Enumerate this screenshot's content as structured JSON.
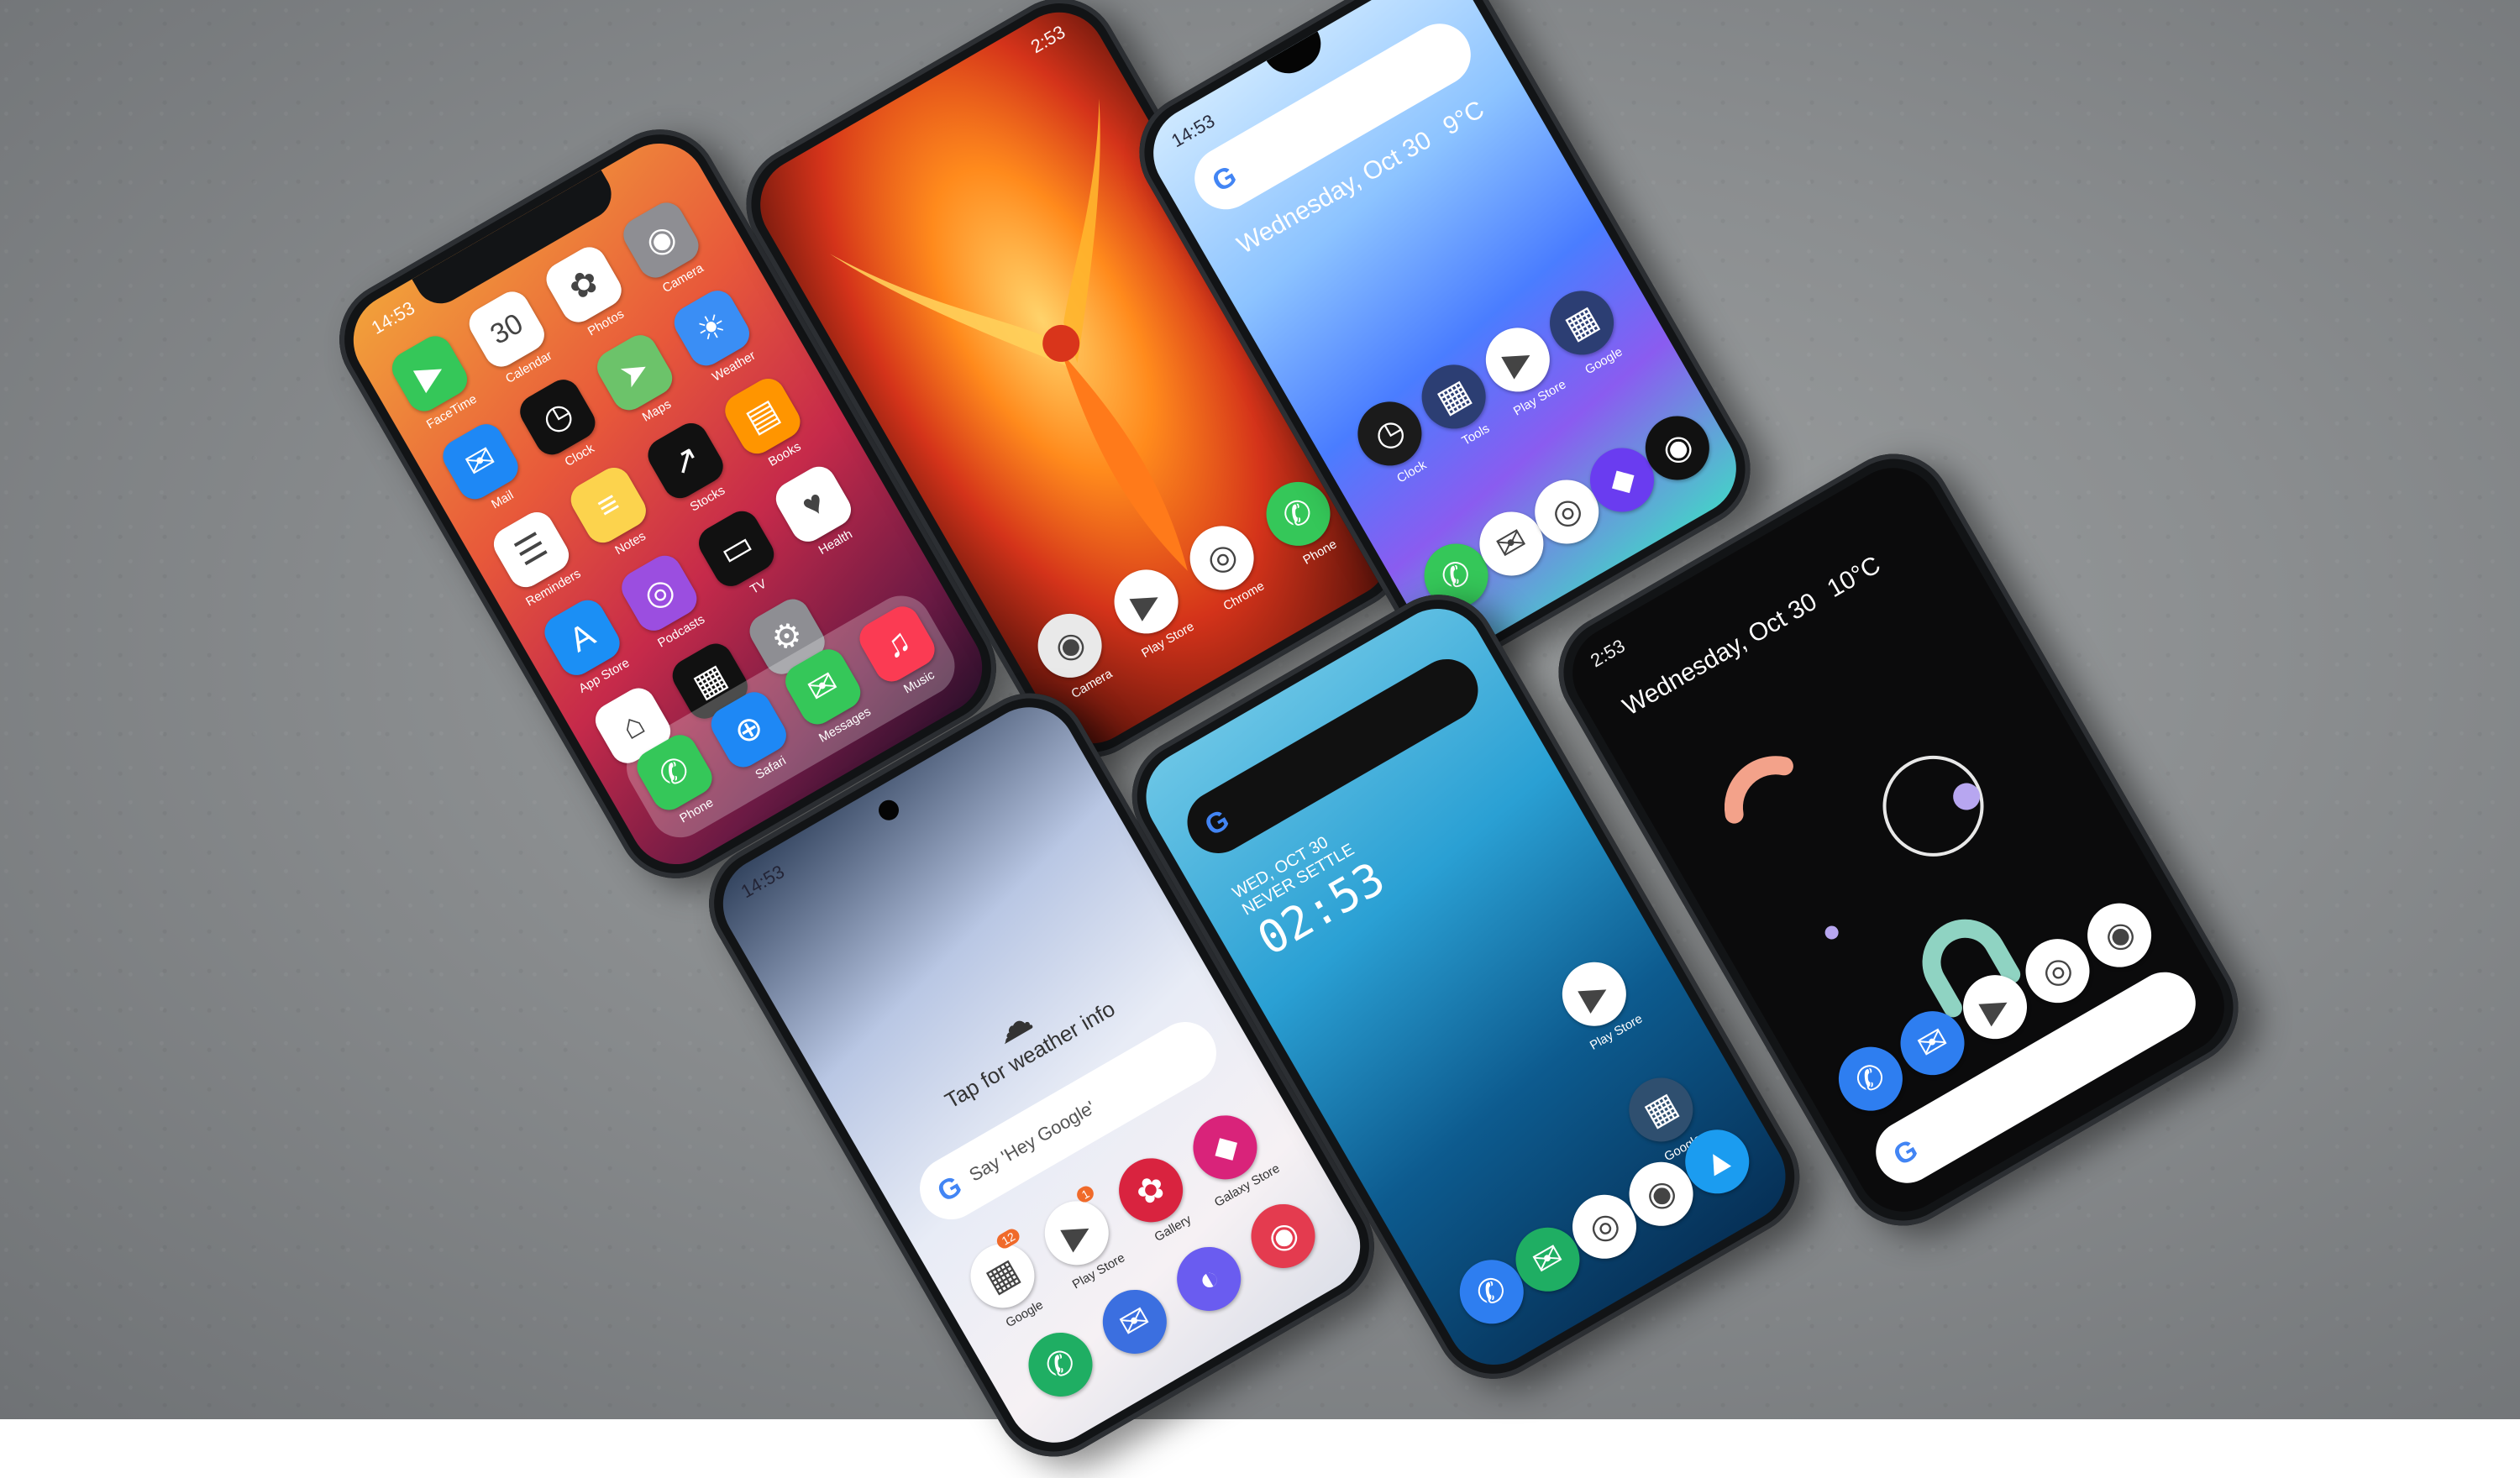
{
  "iphone": {
    "time": "14:53",
    "apps": [
      {
        "label": "FaceTime",
        "icon": "facetime-icon",
        "color": "#35c759"
      },
      {
        "label": "Calendar",
        "icon": "calendar-icon",
        "color": "#ffffff",
        "glyph": "30"
      },
      {
        "label": "Photos",
        "icon": "photos-icon",
        "color": "#ffffff"
      },
      {
        "label": "Camera",
        "icon": "camera-icon",
        "color": "#8e8e93"
      },
      {
        "label": "Mail",
        "icon": "mail-icon",
        "color": "#1e88f5"
      },
      {
        "label": "Clock",
        "icon": "clock-icon",
        "color": "#111111"
      },
      {
        "label": "Maps",
        "icon": "maps-icon",
        "color": "#6cc36a"
      },
      {
        "label": "Weather",
        "icon": "weather-icon",
        "color": "#3a8ef5"
      },
      {
        "label": "Reminders",
        "icon": "reminders-icon",
        "color": "#ffffff"
      },
      {
        "label": "Notes",
        "icon": "notes-icon",
        "color": "#fcd34d"
      },
      {
        "label": "Stocks",
        "icon": "stocks-icon",
        "color": "#111111"
      },
      {
        "label": "Books",
        "icon": "books-icon",
        "color": "#ff9500"
      },
      {
        "label": "App Store",
        "icon": "app-store-icon",
        "color": "#1b8ff5"
      },
      {
        "label": "Podcasts",
        "icon": "podcasts-icon",
        "color": "#9b4ee0"
      },
      {
        "label": "TV",
        "icon": "tv-icon",
        "color": "#111111"
      },
      {
        "label": "Health",
        "icon": "health-icon",
        "color": "#ffffff"
      },
      {
        "label": "Home",
        "icon": "home-icon",
        "color": "#ffffff"
      },
      {
        "label": "Wallet",
        "icon": "wallet-icon",
        "color": "#111111"
      },
      {
        "label": "Settings",
        "icon": "settings-icon",
        "color": "#8e8e93"
      }
    ],
    "dock": [
      {
        "label": "Phone",
        "icon": "phone-icon",
        "color": "#35c759"
      },
      {
        "label": "Safari",
        "icon": "safari-icon",
        "color": "#1e88f5"
      },
      {
        "label": "Messages",
        "icon": "messages-icon",
        "color": "#35c759"
      },
      {
        "label": "Music",
        "icon": "music-icon",
        "color": "#fb3b53"
      }
    ]
  },
  "huawei": {
    "time": "2:53",
    "apps": [
      {
        "label": "Camera",
        "icon": "camera-icon",
        "color": "#e9e9e9"
      },
      {
        "label": "Play Store",
        "icon": "play-store-icon",
        "color": "#ffffff"
      },
      {
        "label": "Chrome",
        "icon": "chrome-icon",
        "color": "#ffffff"
      },
      {
        "label": "Phone",
        "icon": "phone-icon",
        "color": "#35c759"
      }
    ]
  },
  "realme": {
    "time": "14:53",
    "date": "Wednesday, Oct 30",
    "weather": "9°C",
    "apps": [
      {
        "label": "Clock",
        "icon": "clock-icon",
        "color": "#1b1b1b"
      },
      {
        "label": "Tools",
        "icon": "tools-folder-icon",
        "color": "#2c3e73"
      },
      {
        "label": "Play Store",
        "icon": "play-store-icon",
        "color": "#ffffff"
      },
      {
        "label": "Google",
        "icon": "google-folder-icon",
        "color": "#2c3e73"
      }
    ],
    "dock": [
      {
        "label": "",
        "icon": "phone-icon",
        "color": "#35c759"
      },
      {
        "label": "",
        "icon": "messages-icon",
        "color": "#ffffff"
      },
      {
        "label": "",
        "icon": "chrome-icon",
        "color": "#ffffff"
      },
      {
        "label": "",
        "icon": "themes-icon",
        "color": "#6a3cf0"
      },
      {
        "label": "",
        "icon": "camera-icon",
        "color": "#111111"
      }
    ]
  },
  "galaxy": {
    "time": "14:53",
    "weather_text": "Tap for weather info",
    "search_hint": "Say 'Hey Google'",
    "apps": [
      {
        "label": "Google",
        "icon": "google-folder-icon",
        "color": "#ffffff",
        "badge": "12"
      },
      {
        "label": "Play Store",
        "icon": "play-store-icon",
        "color": "#ffffff",
        "badge": "1"
      },
      {
        "label": "Gallery",
        "icon": "gallery-icon",
        "color": "#d9233f"
      },
      {
        "label": "Galaxy Store",
        "icon": "galaxy-store-icon",
        "color": "#d9237a"
      }
    ],
    "dock": [
      {
        "label": "",
        "icon": "phone-icon",
        "color": "#1fae63"
      },
      {
        "label": "",
        "icon": "messages-icon",
        "color": "#3b6fe0"
      },
      {
        "label": "",
        "icon": "internet-icon",
        "color": "#6a5cf0"
      },
      {
        "label": "",
        "icon": "camera-icon",
        "color": "#e43b4f"
      }
    ]
  },
  "oneplus": {
    "date": "WED, OCT 30",
    "weather_line": "NEVER SETTLE",
    "clock": "02:53",
    "apps": [
      {
        "label": "Play Store",
        "icon": "play-store-icon",
        "color": "#ffffff"
      },
      {
        "label": "Google",
        "icon": "google-folder-icon",
        "color": "#2f4f6f"
      }
    ],
    "dock": [
      {
        "label": "",
        "icon": "phone-icon",
        "color": "#2e7ef0"
      },
      {
        "label": "",
        "icon": "messages-icon",
        "color": "#1fae63"
      },
      {
        "label": "",
        "icon": "chrome-icon",
        "color": "#ffffff"
      },
      {
        "label": "",
        "icon": "camera-icon",
        "color": "#ffffff"
      },
      {
        "label": "",
        "icon": "files-icon",
        "color": "#1b9cf0"
      }
    ]
  },
  "pixel": {
    "time": "2:53",
    "date": "Wednesday, Oct 30",
    "weather": "10°C",
    "dock": [
      {
        "label": "",
        "icon": "phone-icon",
        "color": "#2e7ef0"
      },
      {
        "label": "",
        "icon": "messages-icon",
        "color": "#2e7ef0"
      },
      {
        "label": "",
        "icon": "play-store-icon",
        "color": "#ffffff"
      },
      {
        "label": "",
        "icon": "chrome-icon",
        "color": "#ffffff"
      },
      {
        "label": "",
        "icon": "camera-icon",
        "color": "#ffffff"
      }
    ]
  }
}
